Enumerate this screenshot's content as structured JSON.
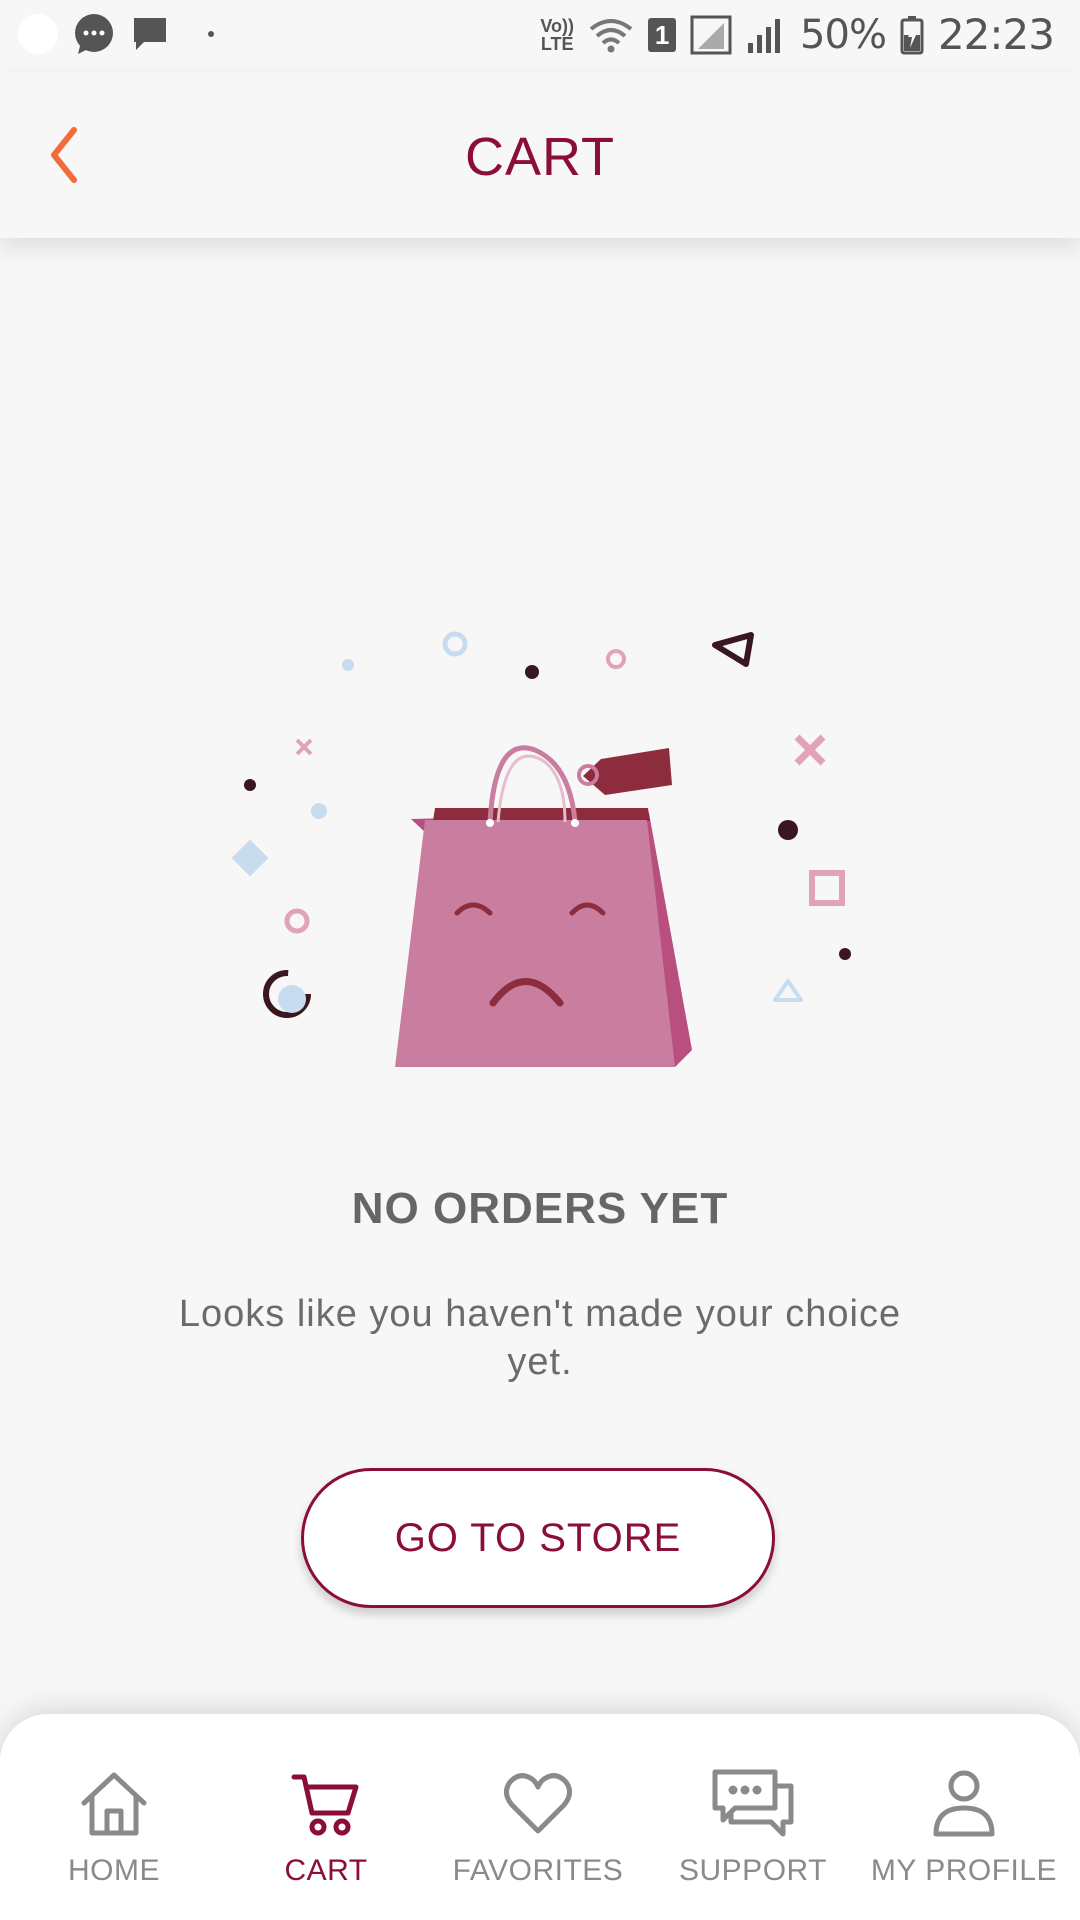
{
  "status_bar": {
    "battery": "50%",
    "time": "22:23",
    "sim_slot": "1",
    "network": [
      "Vo))",
      "LTE"
    ]
  },
  "header": {
    "title": "CART",
    "back_icon": "chevron-left-icon"
  },
  "empty_state": {
    "illustration": "sad-shopping-bag",
    "title": "NO ORDERS YET",
    "message": "Looks like you haven't made your choice yet.",
    "button_label": "GO TO STORE"
  },
  "bottom_nav": {
    "items": [
      {
        "label": "HOME",
        "icon": "home-icon",
        "active": false
      },
      {
        "label": "CART",
        "icon": "cart-icon",
        "active": true
      },
      {
        "label": "FAVORITES",
        "icon": "heart-icon",
        "active": false
      },
      {
        "label": "SUPPORT",
        "icon": "chat-icon",
        "active": false
      },
      {
        "label": "MY PROFILE",
        "icon": "user-icon",
        "active": false
      }
    ]
  },
  "colors": {
    "brand": "#8b0d3a",
    "back_arrow": "#f26b3a",
    "background": "#f7f7f7",
    "bag": "#c97d9f",
    "inactive": "#8a8a8a"
  }
}
